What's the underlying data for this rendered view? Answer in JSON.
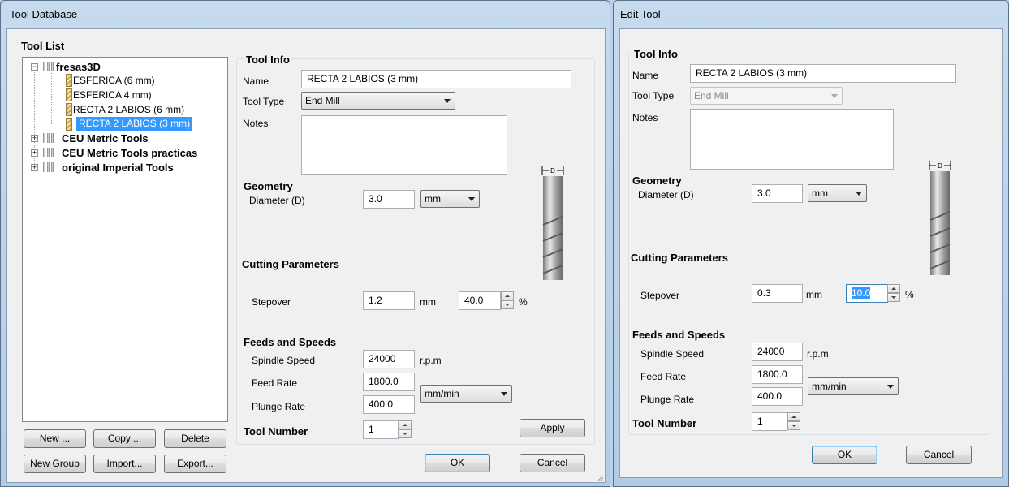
{
  "tool_database": {
    "title": "Tool Database",
    "tool_list_label": "Tool List",
    "tree": [
      {
        "label": "fresas3D",
        "expanded": true,
        "children": [
          "ESFERICA (6 mm)",
          "ESFERICA 4 mm)",
          "RECTA 2 LABIOS (6 mm)",
          "RECTA 2 LABIOS (3 mm)"
        ]
      },
      {
        "label": "CEU Metric Tools"
      },
      {
        "label": "CEU Metric Tools practicas"
      },
      {
        "label": "original Imperial Tools"
      }
    ],
    "selected_tool": "RECTA 2 LABIOS (3 mm)",
    "buttons": {
      "new": "New ...",
      "copy": "Copy ...",
      "delete": "Delete",
      "new_group": "New Group",
      "import": "Import...",
      "export": "Export..."
    },
    "tool_info": {
      "label": "Tool Info",
      "name_label": "Name",
      "name_value": "RECTA 2 LABIOS (3 mm)",
      "tool_type_label": "Tool Type",
      "tool_type_value": "End Mill",
      "notes_label": "Notes",
      "notes_value": ""
    },
    "geometry": {
      "label": "Geometry",
      "diameter_label": "Diameter (D)",
      "diameter_value": "3.0",
      "units": "mm"
    },
    "cutting": {
      "label": "Cutting Parameters",
      "stepover_label": "Stepover",
      "stepover_value": "1.2",
      "stepover_unit": "mm",
      "stepover_percent": "40.0",
      "percent_sign": "%"
    },
    "feeds": {
      "label": "Feeds and Speeds",
      "spindle_label": "Spindle Speed",
      "spindle_value": "24000",
      "spindle_unit": "r.p.m",
      "feed_label": "Feed Rate",
      "feed_value": "1800.0",
      "plunge_label": "Plunge Rate",
      "plunge_value": "400.0",
      "rate_units": "mm/min"
    },
    "tool_number": {
      "label": "Tool Number",
      "value": "1"
    },
    "apply_label": "Apply",
    "ok_label": "OK",
    "cancel_label": "Cancel",
    "diagram_label": "D"
  },
  "edit_tool": {
    "title": "Edit Tool",
    "tool_info": {
      "label": "Tool Info",
      "name_label": "Name",
      "name_value": "RECTA 2 LABIOS (3 mm)",
      "tool_type_label": "Tool Type",
      "tool_type_value": "End Mill",
      "notes_label": "Notes",
      "notes_value": ""
    },
    "geometry": {
      "label": "Geometry",
      "diameter_label": "Diameter (D)",
      "diameter_value": "3.0",
      "units": "mm"
    },
    "cutting": {
      "label": "Cutting Parameters",
      "stepover_label": "Stepover",
      "stepover_value": "0.3",
      "stepover_unit": "mm",
      "stepover_percent": "10.0",
      "percent_sign": "%"
    },
    "feeds": {
      "label": "Feeds and Speeds",
      "spindle_label": "Spindle Speed",
      "spindle_value": "24000",
      "spindle_unit": "r.p.m",
      "feed_label": "Feed Rate",
      "feed_value": "1800.0",
      "plunge_label": "Plunge Rate",
      "plunge_value": "400.0",
      "rate_units": "mm/min"
    },
    "tool_number": {
      "label": "Tool Number",
      "value": "1"
    },
    "ok_label": "OK",
    "cancel_label": "Cancel",
    "diagram_label": "D"
  }
}
